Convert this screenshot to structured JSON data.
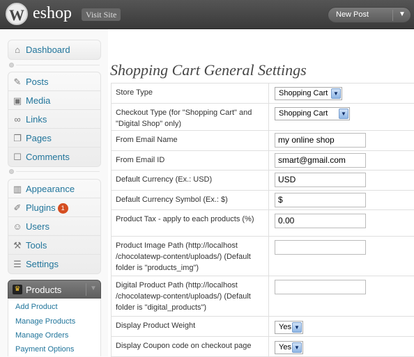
{
  "header": {
    "site_name": "eshop",
    "visit_site": "Visit Site",
    "new_post": "New Post",
    "logo_letter": "W"
  },
  "sidebar": {
    "group1": [
      {
        "label": "Dashboard",
        "icon": "dashboard-icon"
      }
    ],
    "group2": [
      {
        "label": "Posts",
        "icon": "pin-icon"
      },
      {
        "label": "Media",
        "icon": "media-icon"
      },
      {
        "label": "Links",
        "icon": "link-icon"
      },
      {
        "label": "Pages",
        "icon": "page-icon"
      },
      {
        "label": "Comments",
        "icon": "comment-icon"
      }
    ],
    "group3": [
      {
        "label": "Appearance",
        "icon": "appearance-icon"
      },
      {
        "label": "Plugins",
        "icon": "plugin-icon",
        "badge": "1"
      },
      {
        "label": "Users",
        "icon": "users-icon"
      },
      {
        "label": "Tools",
        "icon": "tools-icon"
      },
      {
        "label": "Settings",
        "icon": "settings-icon"
      }
    ],
    "products": {
      "label": "Products",
      "items": [
        "Add Product",
        "Manage Products",
        "Manage Orders",
        "Payment Options"
      ]
    }
  },
  "main": {
    "title": "Shopping Cart General Settings",
    "rows": [
      {
        "label": "Store Type",
        "type": "select",
        "value": "Shopping Cart"
      },
      {
        "label": "Checkout Type (for \"Shopping Cart\" and \"Digital Shop\" only)",
        "type": "select",
        "value": "Shopping Cart"
      },
      {
        "label": "From Email Name",
        "type": "input",
        "value": "my online shop"
      },
      {
        "label": "From Email ID",
        "type": "input",
        "value": "smart@gmail.com"
      },
      {
        "label": "Default Currency (Ex.: USD)",
        "type": "input",
        "value": "USD"
      },
      {
        "label": "Default Currency Symbol (Ex.: $)",
        "type": "input",
        "value": "$"
      },
      {
        "label": "Product Tax - apply to each products (%)",
        "type": "input",
        "value": "0.00"
      },
      {
        "label": "Product Image Path (http://localhost /chocolatewp-content/uploads/) (Default folder is \"products_img\")",
        "type": "input",
        "value": ""
      },
      {
        "label": "Digital Product Path (http://localhost /chocolatewp-content/uploads/) (Default folder is \"digital_products\")",
        "type": "input",
        "value": ""
      },
      {
        "label": "Display Product Weight",
        "type": "select",
        "value": "Yes"
      },
      {
        "label": "Display Coupon code on checkout page",
        "type": "select",
        "value": "Yes"
      }
    ]
  },
  "colors": {
    "link": "#21759b",
    "header_bg": "#464646",
    "badge": "#d54e21"
  }
}
